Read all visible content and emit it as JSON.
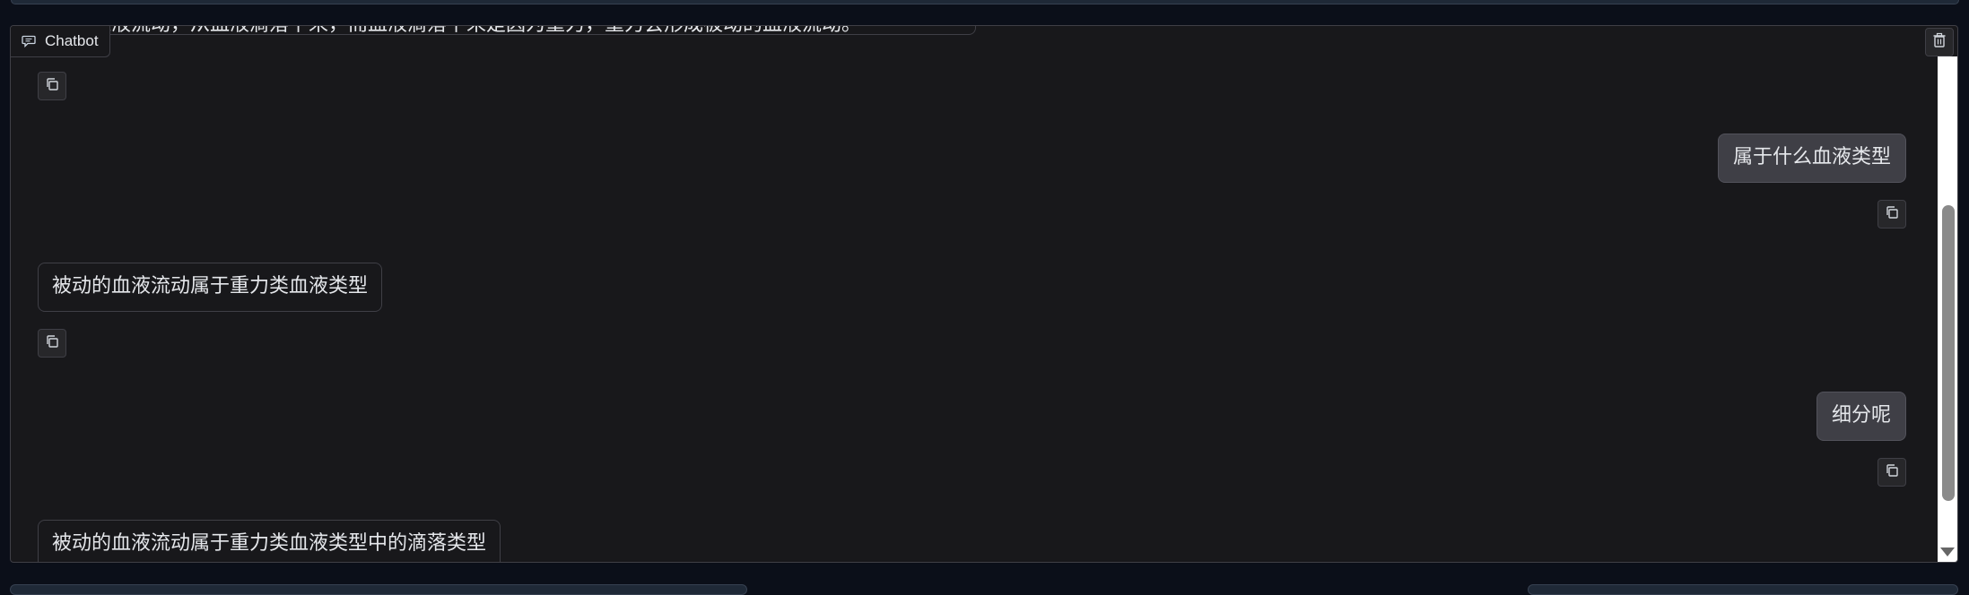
{
  "chatbot": {
    "label": "Chatbot",
    "label_icon": "chat-bubble-icon",
    "clear_icon": "trash-icon",
    "messages": [
      {
        "role": "bot",
        "text": "动的血液流动，从血液滴落下来，而血液滴落下来是因为重力，重力会形成被动的血液流动。",
        "partial": true
      },
      {
        "role": "user",
        "text": "属于什么血液类型"
      },
      {
        "role": "bot",
        "text": "被动的血液流动属于重力类血液类型"
      },
      {
        "role": "user",
        "text": "细分呢"
      },
      {
        "role": "bot",
        "text": "被动的血液流动属于重力类血液类型中的滴落类型"
      }
    ],
    "copy_icon": "copy-icon"
  },
  "colors": {
    "page_bg": "#0b0f19",
    "panel_bg": "#18181b",
    "user_bubble": "#3f3f46",
    "border": "#3f3f46"
  }
}
